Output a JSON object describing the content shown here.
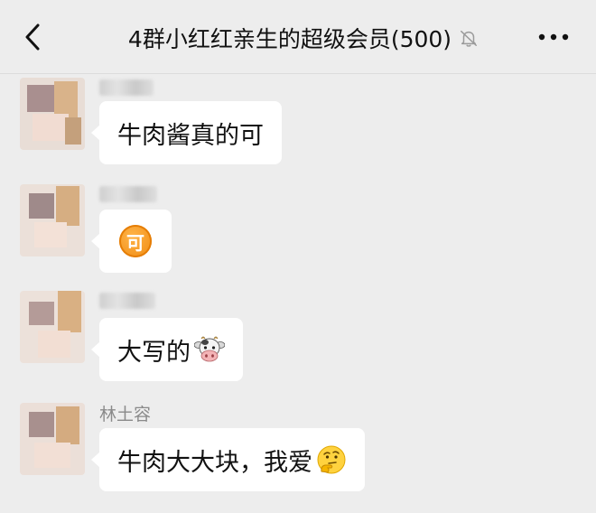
{
  "header": {
    "back_icon": "chevron-left-icon",
    "title": "4群小红红亲生的超级会员(500)",
    "mute_icon": "bell-off-icon",
    "more_icon": "more-horizontal-icon"
  },
  "messages": [
    {
      "sender": "",
      "text": "牛肉酱真的可",
      "emoji": ""
    },
    {
      "sender": "",
      "text": "",
      "emoji": "ke-badge",
      "badge_text": "可"
    },
    {
      "sender": "",
      "text": "大写的",
      "emoji": "cow-face-icon"
    },
    {
      "sender": "林土容",
      "text": "牛肉大大块，我爱",
      "emoji": "thinking-face-icon"
    }
  ],
  "colors": {
    "background": "#ededed",
    "bubble": "#ffffff",
    "badge": "#f08c13"
  }
}
